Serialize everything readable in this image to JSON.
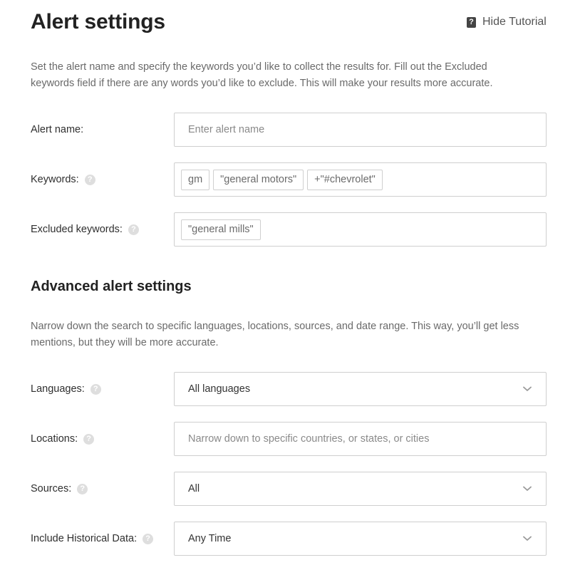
{
  "header": {
    "title": "Alert settings",
    "tutorial_label": "Hide Tutorial",
    "tutorial_icon": "question-mark-icon"
  },
  "basic": {
    "intro": "Set the alert name and specify the keywords you’d like to collect the results for. Fill out the Excluded keywords field if there are any words you’d like to exclude. This will make your results more accurate.",
    "alert_name": {
      "label": "Alert name:",
      "placeholder": "Enter alert name",
      "value": ""
    },
    "keywords": {
      "label": "Keywords:",
      "tags": [
        "gm",
        "\"general motors\"",
        "+\"#chevrolet\""
      ]
    },
    "excluded": {
      "label": "Excluded keywords:",
      "tags": [
        "\"general mills\""
      ]
    }
  },
  "advanced": {
    "title": "Advanced alert settings",
    "intro": "Narrow down the search to specific languages, locations, sources, and date range. This way, you’ll get less mentions, but they will be more accurate.",
    "languages": {
      "label": "Languages:",
      "value": "All languages"
    },
    "locations": {
      "label": "Locations:",
      "placeholder": "Narrow down to specific countries, or states, or cities",
      "value": ""
    },
    "sources": {
      "label": "Sources:",
      "value": "All"
    },
    "historical": {
      "label": "Include Historical Data:",
      "value": "Any Time"
    }
  },
  "colors": {
    "border": "#cfcfcf",
    "help_icon": "#dedede",
    "muted_text": "#6a6a6a"
  }
}
